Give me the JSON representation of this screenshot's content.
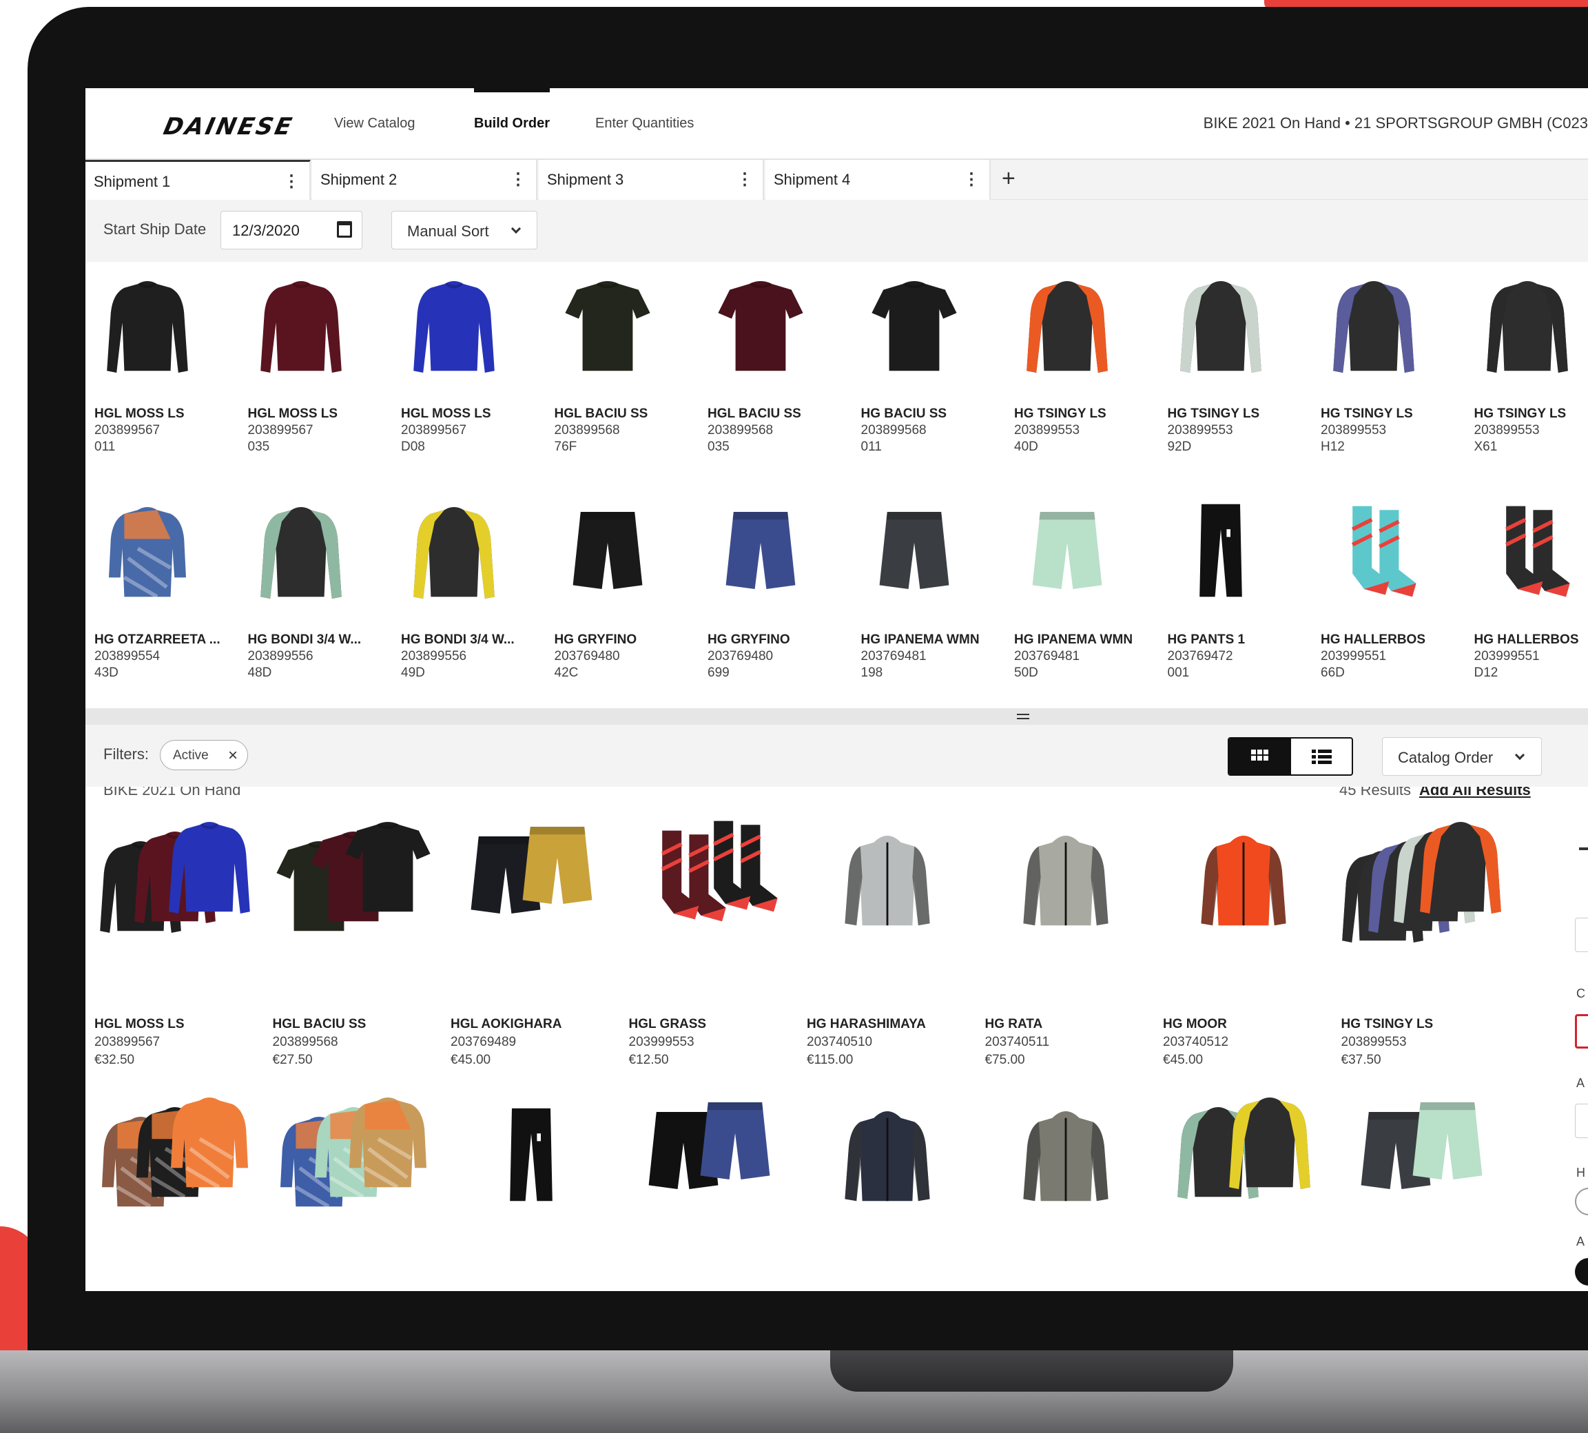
{
  "brand": "DAINESE",
  "nav": {
    "links": [
      "View Catalog",
      "Build Order",
      "Enter Quantities"
    ],
    "context": "BIKE 2021 On Hand • 21 SPORTSGROUP GMBH (C023"
  },
  "shipments": {
    "tabs": [
      "Shipment 1",
      "Shipment 2",
      "Shipment 3",
      "Shipment 4"
    ],
    "start_label": "Start Ship Date",
    "start_date": "12/3/2020",
    "sort": "Manual Sort"
  },
  "order_items": [
    {
      "name": "HGL MOSS LS",
      "code": "203899567",
      "variant": "011",
      "color": "#1f1f1f",
      "type": "ls"
    },
    {
      "name": "HGL MOSS LS",
      "code": "203899567",
      "variant": "035",
      "color": "#5a1420",
      "type": "ls"
    },
    {
      "name": "HGL MOSS LS",
      "code": "203899567",
      "variant": "D08",
      "color": "#2633b8",
      "type": "ls"
    },
    {
      "name": "HGL BACIU SS",
      "code": "203899568",
      "variant": "76F",
      "color": "#22261c",
      "type": "ss"
    },
    {
      "name": "HGL BACIU SS",
      "code": "203899568",
      "variant": "035",
      "color": "#4a121c",
      "type": "ss"
    },
    {
      "name": "HG BACIU SS",
      "code": "203899568",
      "variant": "011",
      "color": "#1c1c1c",
      "type": "ss"
    },
    {
      "name": "HG TSINGY LS",
      "code": "203899553",
      "variant": "40D",
      "color": "#ec5a23",
      "type": "raglan"
    },
    {
      "name": "HG TSINGY LS",
      "code": "203899553",
      "variant": "92D",
      "color": "#c9d5cc",
      "type": "raglan"
    },
    {
      "name": "HG TSINGY LS",
      "code": "203899553",
      "variant": "H12",
      "color": "#5b5c9c",
      "type": "raglan"
    },
    {
      "name": "HG TSINGY LS",
      "code": "203899553",
      "variant": "X61",
      "color": "#2a2a2a",
      "type": "raglan"
    },
    {
      "name": "HG OTZARREETA ...",
      "code": "203899554",
      "variant": "43D",
      "color": "#486aa8",
      "type": "jersey"
    },
    {
      "name": "HG BONDI 3/4 W...",
      "code": "203899556",
      "variant": "48D",
      "color": "#8fb8a2",
      "type": "raglan"
    },
    {
      "name": "HG BONDI 3/4 W...",
      "code": "203899556",
      "variant": "49D",
      "color": "#e4cf2a",
      "type": "raglan"
    },
    {
      "name": "HG GRYFINO",
      "code": "203769480",
      "variant": "42C",
      "color": "#1a1a1a",
      "type": "shorts"
    },
    {
      "name": "HG GRYFINO",
      "code": "203769480",
      "variant": "699",
      "color": "#3b4c8e",
      "type": "shorts"
    },
    {
      "name": "HG IPANEMA WMN",
      "code": "203769481",
      "variant": "198",
      "color": "#3a3d42",
      "type": "shorts"
    },
    {
      "name": "HG IPANEMA WMN",
      "code": "203769481",
      "variant": "50D",
      "color": "#b9e0c8",
      "type": "shorts"
    },
    {
      "name": "HG PANTS 1",
      "code": "203769472",
      "variant": "001",
      "color": "#111111",
      "type": "pants"
    },
    {
      "name": "HG HALLERBOS",
      "code": "203999551",
      "variant": "66D",
      "color": "#5dc8cc",
      "type": "socks"
    },
    {
      "name": "HG HALLERBOS",
      "code": "203999551",
      "variant": "D12",
      "color": "#2b2b2b",
      "type": "socks"
    }
  ],
  "filters": {
    "label": "Filters:",
    "chips": [
      "Active"
    ],
    "catalog_sort": "Catalog Order"
  },
  "catalog": {
    "title": "BIKE 2021 On Hand",
    "results": "45 Results",
    "add_all": "Add All Results",
    "items": [
      {
        "name": "HGL MOSS LS",
        "code": "203899567",
        "price": "€32.50",
        "colors": [
          "#1f1f1f",
          "#5a1420",
          "#2633b8"
        ],
        "type": "ls"
      },
      {
        "name": "HGL BACIU SS",
        "code": "203899568",
        "price": "€27.50",
        "colors": [
          "#22261c",
          "#4a121c",
          "#1c1c1c"
        ],
        "type": "ss"
      },
      {
        "name": "HGL AOKIGHARA",
        "code": "203769489",
        "price": "€45.00",
        "colors": [
          "#1b1c22",
          "#c9a23a"
        ],
        "type": "shorts"
      },
      {
        "name": "HGL GRASS",
        "code": "203999553",
        "price": "€12.50",
        "colors": [
          "#5a1a20",
          "#1c1c1c"
        ],
        "type": "socks"
      },
      {
        "name": "HG HARASHIMAYA",
        "code": "203740510",
        "price": "€115.00",
        "colors": [
          "#b8bcbc"
        ],
        "type": "jacket"
      },
      {
        "name": "HG RATA",
        "code": "203740511",
        "price": "€75.00",
        "colors": [
          "#a8aaa2"
        ],
        "type": "jacket"
      },
      {
        "name": "HG MOOR",
        "code": "203740512",
        "price": "€45.00",
        "colors": [
          "#f04a1e"
        ],
        "type": "jacket"
      },
      {
        "name": "HG TSINGY LS",
        "code": "203899553",
        "price": "€37.50",
        "colors": [
          "#2a2a2a",
          "#5b5c9c",
          "#c9d5cc",
          "#ec5a23"
        ],
        "type": "raglan"
      },
      {
        "name": "",
        "code": "",
        "price": "",
        "colors": [
          "#8a5a44",
          "#1e1e1e",
          "#f07e3a"
        ],
        "type": "jersey"
      },
      {
        "name": "",
        "code": "",
        "price": "",
        "colors": [
          "#3e5ea8",
          "#a8d6c0",
          "#c99b5a"
        ],
        "type": "jersey"
      },
      {
        "name": "",
        "code": "",
        "price": "",
        "colors": [
          "#111111"
        ],
        "type": "pants"
      },
      {
        "name": "",
        "code": "",
        "price": "",
        "colors": [
          "#111111",
          "#3b4c8e"
        ],
        "type": "shorts"
      },
      {
        "name": "",
        "code": "",
        "price": "",
        "colors": [
          "#2a3040"
        ],
        "type": "jacket"
      },
      {
        "name": "",
        "code": "",
        "price": "",
        "colors": [
          "#7a7a70"
        ],
        "type": "jacket"
      },
      {
        "name": "",
        "code": "",
        "price": "",
        "colors": [
          "#8fb8a2",
          "#e4cf2a"
        ],
        "type": "raglan"
      },
      {
        "name": "",
        "code": "",
        "price": "",
        "colors": [
          "#3a3d42",
          "#b9e0c8"
        ],
        "type": "shorts"
      }
    ]
  },
  "side_panel": {
    "letters": [
      "C",
      "A",
      "H",
      "A"
    ]
  }
}
